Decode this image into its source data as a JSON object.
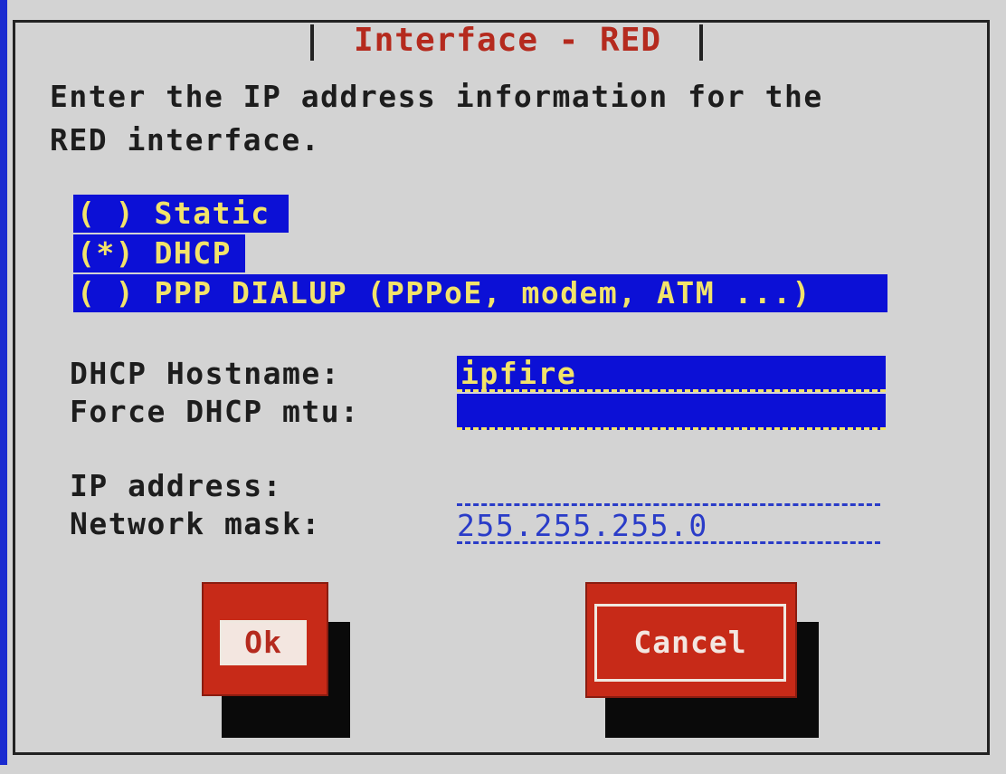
{
  "dialog": {
    "title": "Interface - RED",
    "prompt_line1": "Enter the IP address information for the",
    "prompt_line2": "RED interface."
  },
  "mode_options": [
    {
      "label": "( ) Static"
    },
    {
      "label": "(*) DHCP"
    },
    {
      "label": "( ) PPP DIALUP (PPPoE, modem, ATM ...)"
    }
  ],
  "dhcp": {
    "hostname_label": "DHCP Hostname:",
    "hostname_value": "ipfire",
    "mtu_label": "Force DHCP mtu:",
    "mtu_value": ""
  },
  "static": {
    "ip_label": "IP address:",
    "ip_value": "",
    "mask_label": "Network mask:",
    "mask_value": "255.255.255.0"
  },
  "buttons": {
    "ok_label": "Ok",
    "cancel_label": "Cancel"
  },
  "colors": {
    "selection_bg": "#0c10d6",
    "selection_text": "#f2e36a",
    "title_red": "#b52a1e",
    "button_red": "#c72a18"
  }
}
